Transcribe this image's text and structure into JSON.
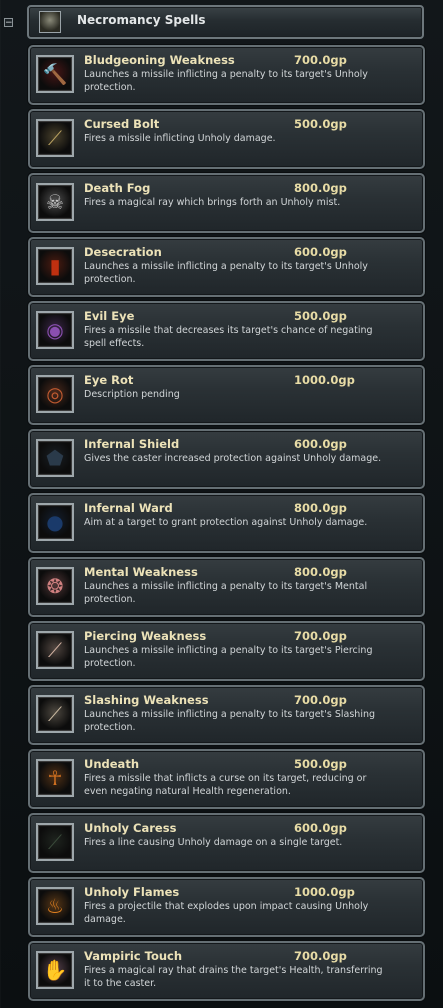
{
  "category": {
    "title": "Necromancy Spells",
    "icon": "skull-icon",
    "collapse_symbol": "−"
  },
  "spells": [
    {
      "name": "Bludgeoning Weakness",
      "price": "700.0gp",
      "description": "Launches a missile inflicting a penalty to its target's Unholy protection.",
      "icon": "bludgeon-icon",
      "glyph": "🔨",
      "color": "#b32020"
    },
    {
      "name": "Cursed Bolt",
      "price": "500.0gp",
      "description": "Fires a missile inflicting Unholy damage.",
      "icon": "bolt-icon",
      "glyph": "⟋",
      "color": "#b8a060"
    },
    {
      "name": "Death Fog",
      "price": "800.0gp",
      "description": "Fires a magical ray which brings forth an Unholy mist.",
      "icon": "ghost-skull-icon",
      "glyph": "☠",
      "color": "#c8c8c8"
    },
    {
      "name": "Desecration",
      "price": "600.0gp",
      "description": "Launches a missile inflicting a penalty to its target's Unholy protection.",
      "icon": "flame-icon",
      "glyph": "▮",
      "color": "#c03010"
    },
    {
      "name": "Evil Eye",
      "price": "500.0gp",
      "description": "Fires a missile that decreases its target's chance of negating spell effects.",
      "icon": "eye-icon",
      "glyph": "◉",
      "color": "#8a4fb0"
    },
    {
      "name": "Eye Rot",
      "price": "1000.0gp",
      "description": "Description pending",
      "icon": "rotting-eye-icon",
      "glyph": "◎",
      "color": "#c05a30"
    },
    {
      "name": "Infernal Shield",
      "price": "600.0gp",
      "description": "Gives the caster increased protection against Unholy damage.",
      "icon": "shield-icon",
      "glyph": "⬟",
      "color": "#2a3a4a"
    },
    {
      "name": "Infernal Ward",
      "price": "800.0gp",
      "description": "Aim at a target to grant protection against Unholy damage.",
      "icon": "ward-orb-icon",
      "glyph": "●",
      "color": "#1a3a6a"
    },
    {
      "name": "Mental Weakness",
      "price": "800.0gp",
      "description": "Launches a missile inflicting a penalty to its target's Mental protection.",
      "icon": "brain-icon",
      "glyph": "❂",
      "color": "#d08080"
    },
    {
      "name": "Piercing Weakness",
      "price": "700.0gp",
      "description": "Launches a missile inflicting a penalty to its target's Piercing protection.",
      "icon": "spear-icon",
      "glyph": "⟋",
      "color": "#d0b0a0"
    },
    {
      "name": "Slashing Weakness",
      "price": "700.0gp",
      "description": "Launches a missile inflicting a penalty to its target's Slashing protection.",
      "icon": "blade-icon",
      "glyph": "⟋",
      "color": "#c8b8a0"
    },
    {
      "name": "Undeath",
      "price": "500.0gp",
      "description": "Fires a missile that inflicts a curse on its target, reducing or even negating natural Health regeneration.",
      "icon": "ankh-icon",
      "glyph": "☥",
      "color": "#d07020"
    },
    {
      "name": "Unholy Caress",
      "price": "600.0gp",
      "description": "Fires a line causing Unholy damage on a single target.",
      "icon": "feather-icon",
      "glyph": "⟋",
      "color": "#3a4a3a"
    },
    {
      "name": "Unholy Flames",
      "price": "1000.0gp",
      "description": "Fires a projectile that explodes upon impact causing Unholy damage.",
      "icon": "fire-icon",
      "glyph": "♨",
      "color": "#e08020"
    },
    {
      "name": "Vampiric Touch",
      "price": "700.0gp",
      "description": "Fires a magical ray that drains the target's Health, transferring it to the caster.",
      "icon": "hand-icon",
      "glyph": "✋",
      "color": "#e0a0c0"
    }
  ]
}
